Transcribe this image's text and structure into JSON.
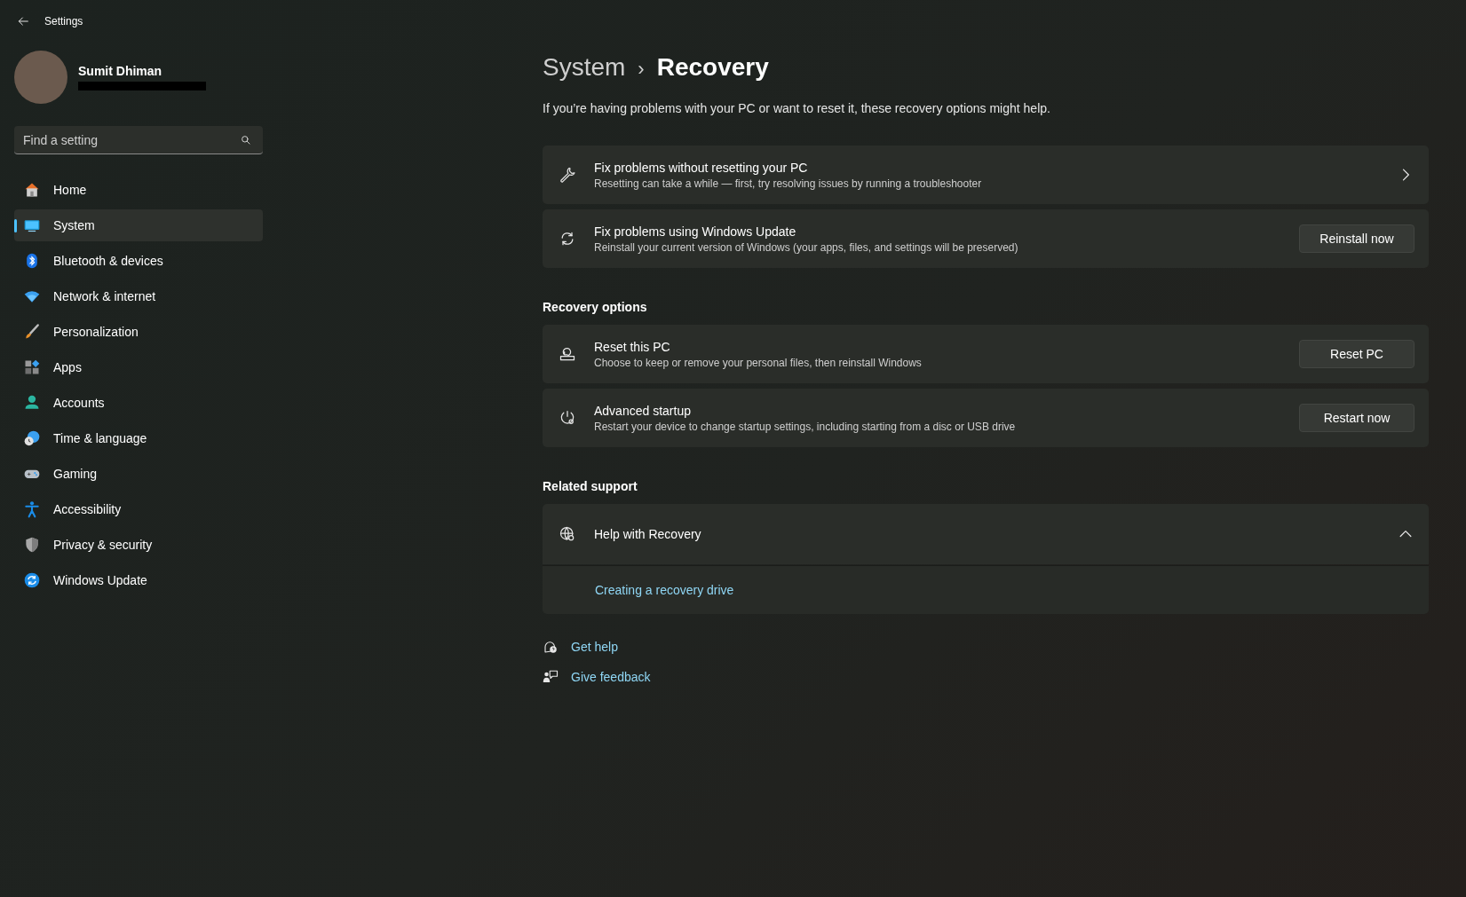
{
  "window": {
    "title": "Settings"
  },
  "profile": {
    "name": "Sumit Dhiman"
  },
  "search": {
    "placeholder": "Find a setting"
  },
  "sidebar": {
    "items": [
      {
        "label": "Home",
        "selected": false
      },
      {
        "label": "System",
        "selected": true
      },
      {
        "label": "Bluetooth & devices",
        "selected": false
      },
      {
        "label": "Network & internet",
        "selected": false
      },
      {
        "label": "Personalization",
        "selected": false
      },
      {
        "label": "Apps",
        "selected": false
      },
      {
        "label": "Accounts",
        "selected": false
      },
      {
        "label": "Time & language",
        "selected": false
      },
      {
        "label": "Gaming",
        "selected": false
      },
      {
        "label": "Accessibility",
        "selected": false
      },
      {
        "label": "Privacy & security",
        "selected": false
      },
      {
        "label": "Windows Update",
        "selected": false
      }
    ]
  },
  "breadcrumb": {
    "parent": "System",
    "separator": "›",
    "current": "Recovery"
  },
  "intro": "If you’re having problems with your PC or want to reset it, these recovery options might help.",
  "sections": [
    {
      "cards": [
        {
          "kind": "chevron",
          "title": "Fix problems without resetting your PC",
          "description": "Resetting can take a while — first, try resolving issues by running a troubleshooter"
        },
        {
          "kind": "button",
          "title": "Fix problems using Windows Update",
          "description": "Reinstall your current version of Windows (your apps, files, and settings will be preserved)",
          "button": "Reinstall now"
        }
      ]
    },
    {
      "heading": "Recovery options",
      "cards": [
        {
          "kind": "button",
          "title": "Reset this PC",
          "description": "Choose to keep or remove your personal files, then reinstall Windows",
          "button": "Reset PC"
        },
        {
          "kind": "button",
          "title": "Advanced startup",
          "description": "Restart your device to change startup settings, including starting from a disc or USB drive",
          "button": "Restart now"
        }
      ]
    }
  ],
  "related_support": {
    "heading": "Related support",
    "expander": {
      "title": "Help with Recovery",
      "expanded": true,
      "links": [
        "Creating a recovery drive"
      ]
    }
  },
  "footer_links": [
    {
      "label": "Get help"
    },
    {
      "label": "Give feedback"
    }
  ]
}
